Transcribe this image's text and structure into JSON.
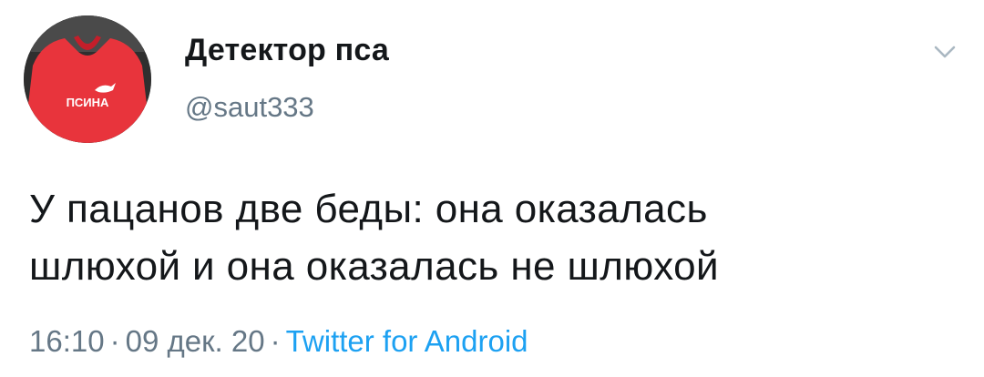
{
  "user": {
    "display_name": "Детектор пса",
    "handle": "@saut333",
    "avatar_shirt_text": "ПСИНА"
  },
  "tweet": {
    "text_line_1": "У пацанов две беды: она оказалась",
    "text_line_2": "шлюхой и она оказалась не шлюхой"
  },
  "meta": {
    "time": "16:10",
    "separator": "·",
    "date": "09 дек. 20",
    "source": "Twitter for Android"
  },
  "icons": {
    "menu": "chevron-down-icon"
  },
  "colors": {
    "text": "#14171a",
    "secondary": "#657786",
    "link": "#1da1f2",
    "avatar_shirt": "#e8343c"
  }
}
